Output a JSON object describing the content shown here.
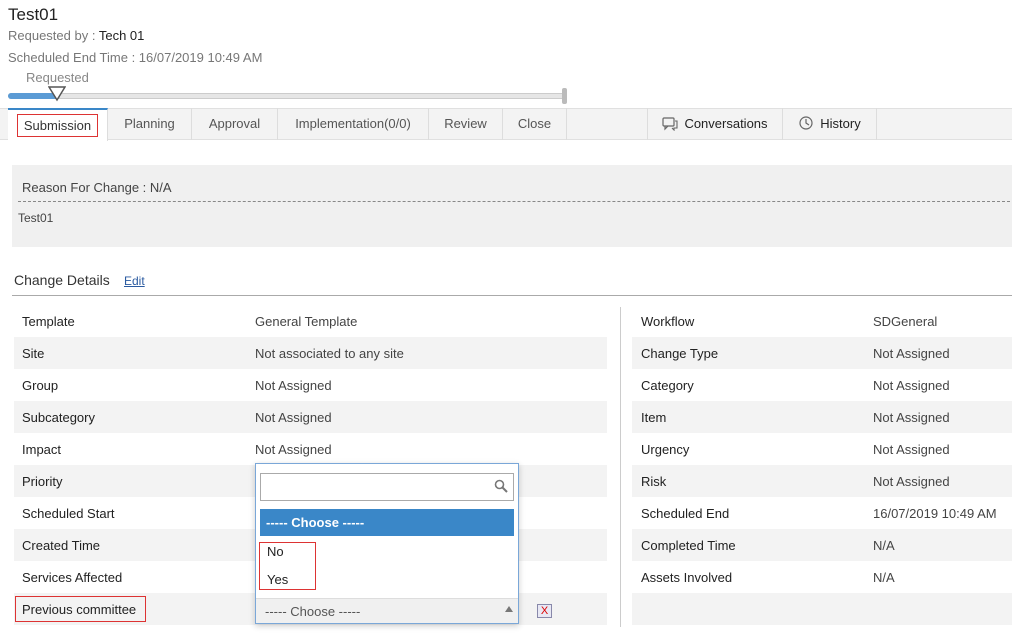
{
  "header": {
    "title": "Test01",
    "requested_by_label": "Requested by :",
    "requested_by_value": "Tech 01",
    "scheduled_end": "Scheduled End Time : 16/07/2019 10:49 AM",
    "stage_label": "Requested"
  },
  "tabs": {
    "submission": "Submission",
    "planning": "Planning",
    "approval": "Approval",
    "implementation": "Implementation(0/0)",
    "review": "Review",
    "close": "Close",
    "conversations": "Conversations",
    "history": "History"
  },
  "reason": {
    "label": "Reason For Change : N/A",
    "text": "Test01"
  },
  "change_details": {
    "title": "Change Details",
    "edit_link": "Edit",
    "left": [
      {
        "label": "Template",
        "value": "General Template"
      },
      {
        "label": "Site",
        "value": "Not associated to any site"
      },
      {
        "label": "Group",
        "value": "Not Assigned"
      },
      {
        "label": "Subcategory",
        "value": "Not Assigned"
      },
      {
        "label": "Impact",
        "value": "Not Assigned"
      },
      {
        "label": "Priority",
        "value": ""
      },
      {
        "label": "Scheduled Start",
        "value": ""
      },
      {
        "label": "Created Time",
        "value": ""
      },
      {
        "label": "Services Affected",
        "value": ""
      },
      {
        "label": "Previous committee",
        "value": ""
      }
    ],
    "right": [
      {
        "label": "Workflow",
        "value": "SDGeneral"
      },
      {
        "label": "Change Type",
        "value": "Not Assigned"
      },
      {
        "label": "Category",
        "value": "Not Assigned"
      },
      {
        "label": "Item",
        "value": "Not Assigned"
      },
      {
        "label": "Urgency",
        "value": "Not Assigned"
      },
      {
        "label": "Risk",
        "value": "Not Assigned"
      },
      {
        "label": "Scheduled End",
        "value": "16/07/2019 10:49 AM"
      },
      {
        "label": "Completed Time",
        "value": "N/A"
      },
      {
        "label": "Assets Involved",
        "value": "N/A"
      }
    ]
  },
  "dropdown": {
    "search_value": "",
    "highlighted": "----- Choose -----",
    "options": [
      "No",
      "Yes"
    ],
    "selected": "----- Choose -----",
    "clear_label": "X"
  },
  "colors": {
    "accent": "#3a87c8",
    "highlight_border": "#dd3333"
  }
}
